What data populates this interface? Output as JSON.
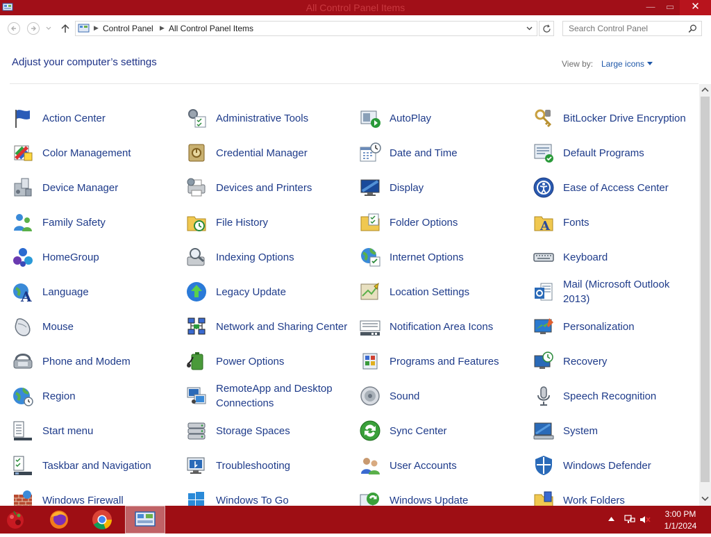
{
  "window": {
    "title": "All Control Panel Items",
    "minimize_glyph": "—",
    "maximize_glyph": "▭",
    "close_glyph": "✕"
  },
  "nav": {
    "breadcrumb": [
      "Control Panel",
      "All Control Panel Items"
    ],
    "search_placeholder": "Search Control Panel"
  },
  "content": {
    "heading": "Adjust your computer’s settings",
    "view_by_label": "View by:",
    "view_by_value": "Large icons"
  },
  "items": [
    {
      "label": "Action Center",
      "icon": "flag-icon"
    },
    {
      "label": "Administrative Tools",
      "icon": "gear-checklist-icon"
    },
    {
      "label": "AutoPlay",
      "icon": "autoplay-icon"
    },
    {
      "label": "BitLocker Drive Encryption",
      "icon": "keys-icon"
    },
    {
      "label": "Color Management",
      "icon": "color-icon"
    },
    {
      "label": "Credential Manager",
      "icon": "vault-icon"
    },
    {
      "label": "Date and Time",
      "icon": "calendar-clock-icon"
    },
    {
      "label": "Default Programs",
      "icon": "default-programs-icon"
    },
    {
      "label": "Device Manager",
      "icon": "device-manager-icon"
    },
    {
      "label": "Devices and Printers",
      "icon": "printer-icon"
    },
    {
      "label": "Display",
      "icon": "monitor-icon"
    },
    {
      "label": "Ease of Access Center",
      "icon": "ease-access-icon"
    },
    {
      "label": "Family Safety",
      "icon": "family-icon"
    },
    {
      "label": "File History",
      "icon": "file-history-icon"
    },
    {
      "label": "Folder Options",
      "icon": "folder-options-icon"
    },
    {
      "label": "Fonts",
      "icon": "fonts-folder-icon"
    },
    {
      "label": "HomeGroup",
      "icon": "homegroup-icon"
    },
    {
      "label": "Indexing Options",
      "icon": "indexing-icon"
    },
    {
      "label": "Internet Options",
      "icon": "globe-check-icon"
    },
    {
      "label": "Keyboard",
      "icon": "keyboard-icon"
    },
    {
      "label": "Language",
      "icon": "language-icon"
    },
    {
      "label": "Legacy Update",
      "icon": "update-arrow-icon"
    },
    {
      "label": "Location Settings",
      "icon": "location-icon"
    },
    {
      "label": "Mail (Microsoft Outlook 2013)",
      "icon": "mail-icon"
    },
    {
      "label": "Mouse",
      "icon": "mouse-icon"
    },
    {
      "label": "Network and Sharing Center",
      "icon": "network-icon"
    },
    {
      "label": "Notification Area Icons",
      "icon": "notification-icon"
    },
    {
      "label": "Personalization",
      "icon": "personalization-icon"
    },
    {
      "label": "Phone and Modem",
      "icon": "phone-icon"
    },
    {
      "label": "Power Options",
      "icon": "battery-icon"
    },
    {
      "label": "Programs and Features",
      "icon": "programs-icon"
    },
    {
      "label": "Recovery",
      "icon": "recovery-icon"
    },
    {
      "label": "Region",
      "icon": "region-icon"
    },
    {
      "label": "RemoteApp and Desktop Connections",
      "icon": "remoteapp-icon"
    },
    {
      "label": "Sound",
      "icon": "speaker-icon"
    },
    {
      "label": "Speech Recognition",
      "icon": "microphone-icon"
    },
    {
      "label": "Start menu",
      "icon": "start-menu-icon"
    },
    {
      "label": "Storage Spaces",
      "icon": "storage-icon"
    },
    {
      "label": "Sync Center",
      "icon": "sync-icon"
    },
    {
      "label": "System",
      "icon": "system-icon"
    },
    {
      "label": "Taskbar and Navigation",
      "icon": "taskbar-icon"
    },
    {
      "label": "Troubleshooting",
      "icon": "troubleshoot-icon"
    },
    {
      "label": "User Accounts",
      "icon": "users-icon"
    },
    {
      "label": "Windows Defender",
      "icon": "shield-icon"
    },
    {
      "label": "Windows Firewall",
      "icon": "firewall-icon"
    },
    {
      "label": "Windows To Go",
      "icon": "windows-to-go-icon"
    },
    {
      "label": "Windows Update",
      "icon": "windows-update-icon"
    },
    {
      "label": "Work Folders",
      "icon": "work-folders-icon"
    }
  ],
  "taskbar": {
    "time": "3:00 PM",
    "date": "1/1/2024",
    "apps": [
      "firefox-icon",
      "chrome-icon",
      "control-panel-icon"
    ]
  },
  "colors": {
    "titlebar": "#a10f18",
    "taskbar": "#9e0e14",
    "link": "#1e3b8a",
    "heading": "#1e3287"
  }
}
